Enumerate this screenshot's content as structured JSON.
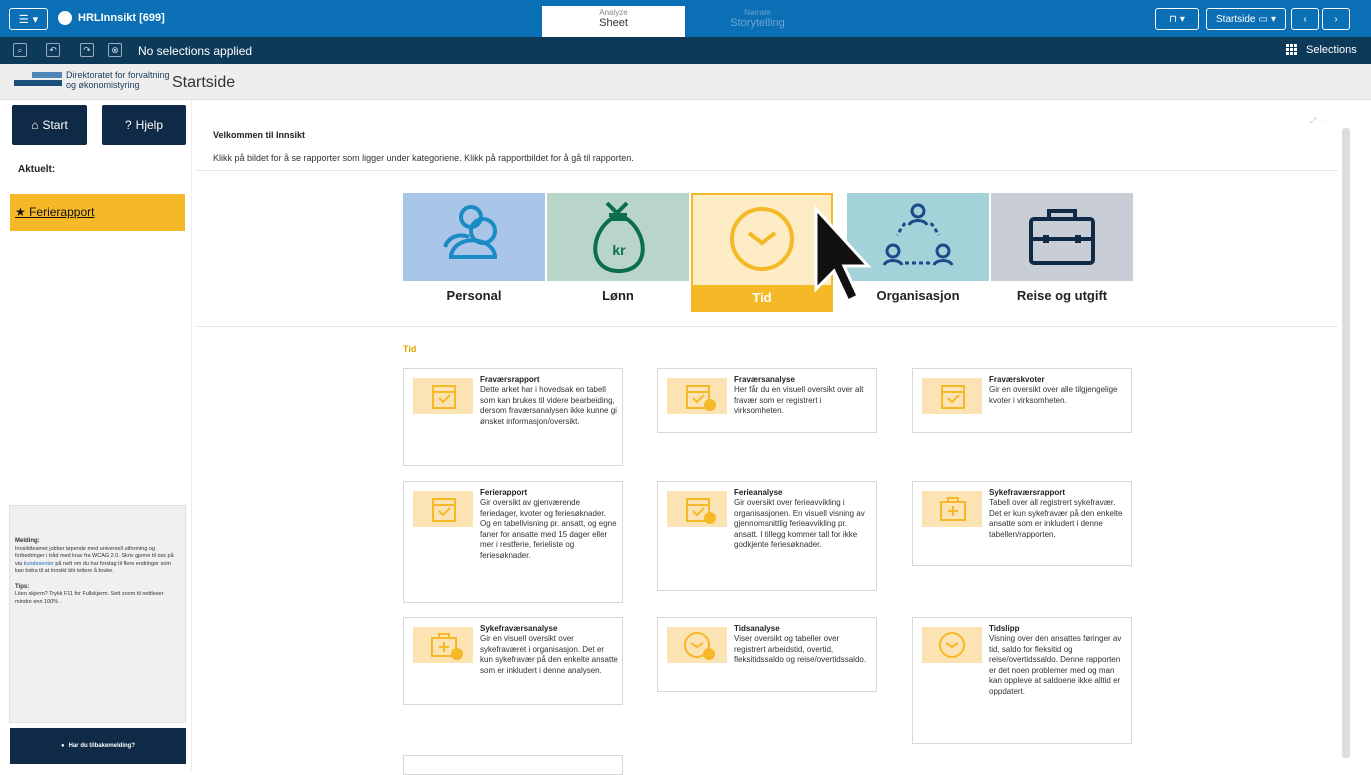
{
  "topbar": {
    "app_title": "HRLInnsikt [699]",
    "tabs": [
      {
        "small": "Analyze",
        "big": "Sheet"
      },
      {
        "small": "Narrate",
        "big": "Storytelling"
      }
    ],
    "sheet_select": "Startside"
  },
  "selection_bar": {
    "status": "No selections applied",
    "selections_label": "Selections"
  },
  "header": {
    "logo_line1": "Direktoratet for forvaltning",
    "logo_line2": "og økonomistyring",
    "page_title": "Startside"
  },
  "sidebar": {
    "start_label": "Start",
    "help_label": "Hjelp",
    "aktuelt_label": "Aktuelt:",
    "featured_link": "Ferierapport",
    "message_title": "Melding:",
    "message_text_a": "Innsiktteamet jobber løpende med universell utforming og forbedringer i tråd med krav fra WCAG 2.0. Skriv gjerne til oss på via ",
    "message_link": "kundesenter",
    "message_text_b": " på nett om du har forslag til flere endringer som kan bidra til at Innsikt blir lettere å bruke.",
    "tips_title": "Tips:",
    "tips_text": "Liten skjerm? Trykk F11 for Fullskjerm. Sett zoom til nettleser mindre enn 100% .",
    "feedback_label": "Har du tilbakemelding?"
  },
  "main": {
    "welcome_title": "Velkommen til Innsikt",
    "instructions": "Klikk på bildet for å se rapporter som ligger under kategoriene. Klikk på rapportbildet for å gå til rapporten.",
    "categories": [
      {
        "label": "Personal",
        "color": "#a9c6e8"
      },
      {
        "label": "Lønn",
        "color": "#b9d5c9"
      },
      {
        "label": "Tid",
        "color": "#fdecc4"
      },
      {
        "label": "Organisasjon",
        "color": "#a3d3d9"
      },
      {
        "label": "Reise og utgift",
        "color": "#c9ced6"
      }
    ],
    "section_title": "Tid",
    "reports": [
      {
        "title": "Fraværsrapport",
        "desc": "Dette arket har i hovedsak en tabell som kan brukes til videre bearbeiding, dersom fraværsanalysen ikke kunne gi ønsket informasjon/oversikt."
      },
      {
        "title": "Fraværsanalyse",
        "desc": "Her får du en visuell oversikt over alt fravær som er registrert i virksomheten."
      },
      {
        "title": "Fraværskvoter",
        "desc": "Gir en oversikt over alle tilgjengelige kvoter i virksomheten."
      },
      {
        "title": "Ferierapport",
        "desc": "Gir oversikt av gjenværende feriedager, kvoter og feriesøknader. Og en tabellvisning pr. ansatt, og egne faner for ansatte med 15 dager eller mer i restferie, ferieliste og feriesøknader."
      },
      {
        "title": "Ferieanalyse",
        "desc": "Gir oversikt over ferieavvikling i organisasjonen. En visuell visning av gjennomsnittlig ferieavvikling pr. ansatt. I tillegg kommer tall for ikke godkjente feriesøknader."
      },
      {
        "title": "Sykefraværsrapport",
        "desc": "Tabell over all registrert sykefravær. Det er kun sykefravær på den enkelte ansatte som er inkludert i denne tabellen/rapporten."
      },
      {
        "title": "Sykefraværsanalyse",
        "desc": "Gir en visuell oversikt over sykefraværet i organisasjon. Det er kun sykefravær på den enkelte ansatte som er inkludert i denne analysen."
      },
      {
        "title": "Tidsanalyse",
        "desc": "Viser oversikt og tabeller over registrert arbeidstid, overtid, fleksitidssaldo og reise/overtidssaldo."
      },
      {
        "title": "Tidslipp",
        "desc": "Visning over den ansattes føringer av tid, saldo for fleksitid og reise/overtidssaldo. Denne rapporten er det noen problemer med og man kan oppleve at saldoene ikke alltid er oppdatert."
      }
    ]
  },
  "colors": {
    "topbar": "#0a6fb4",
    "selbar": "#0e3a5a",
    "accent": "#f5b826",
    "dark_button": "#0f2a47"
  }
}
